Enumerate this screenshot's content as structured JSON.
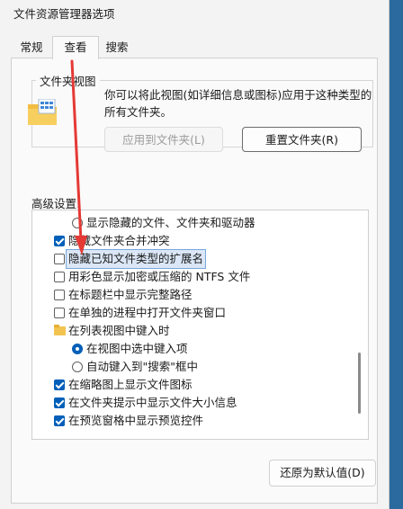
{
  "window": {
    "title": "文件资源管理器选项"
  },
  "tabs": [
    {
      "label": "常规"
    },
    {
      "label": "查看"
    },
    {
      "label": "搜索"
    }
  ],
  "folder_views": {
    "legend": "文件夹视图",
    "description": "你可以将此视图(如详细信息或图标)应用于这种类型的所有文件夹。",
    "apply_button": "应用到文件夹(L)",
    "reset_button": "重置文件夹(R)"
  },
  "advanced": {
    "label": "高级设置:",
    "items": [
      {
        "text": "显示隐藏的文件、文件夹和驱动器",
        "control": "radio",
        "checked": false
      },
      {
        "text": "隐藏文件夹合并冲突",
        "control": "checkbox",
        "checked": true
      },
      {
        "text": "隐藏已知文件类型的扩展名",
        "control": "checkbox",
        "checked": false,
        "selected": true
      },
      {
        "text": "用彩色显示加密或压缩的 NTFS 文件",
        "control": "checkbox",
        "checked": false
      },
      {
        "text": "在标题栏中显示完整路径",
        "control": "checkbox",
        "checked": false
      },
      {
        "text": "在单独的进程中打开文件夹窗口",
        "control": "checkbox",
        "checked": false
      },
      {
        "text": "在列表视图中键入时",
        "control": "folder"
      },
      {
        "text": "在视图中选中键入项",
        "control": "radio",
        "checked": true
      },
      {
        "text": "自动键入到\"搜索\"框中",
        "control": "radio",
        "checked": false
      },
      {
        "text": "在缩略图上显示文件图标",
        "control": "checkbox",
        "checked": true
      },
      {
        "text": "在文件夹提示中显示文件大小信息",
        "control": "checkbox",
        "checked": true
      },
      {
        "text": "在预览窗格中显示预览控件",
        "control": "checkbox",
        "checked": true
      }
    ]
  },
  "restore_button": "还原为默认值(D)",
  "colors": {
    "accent": "#005fb8",
    "annotation_arrow": "#e53935"
  }
}
